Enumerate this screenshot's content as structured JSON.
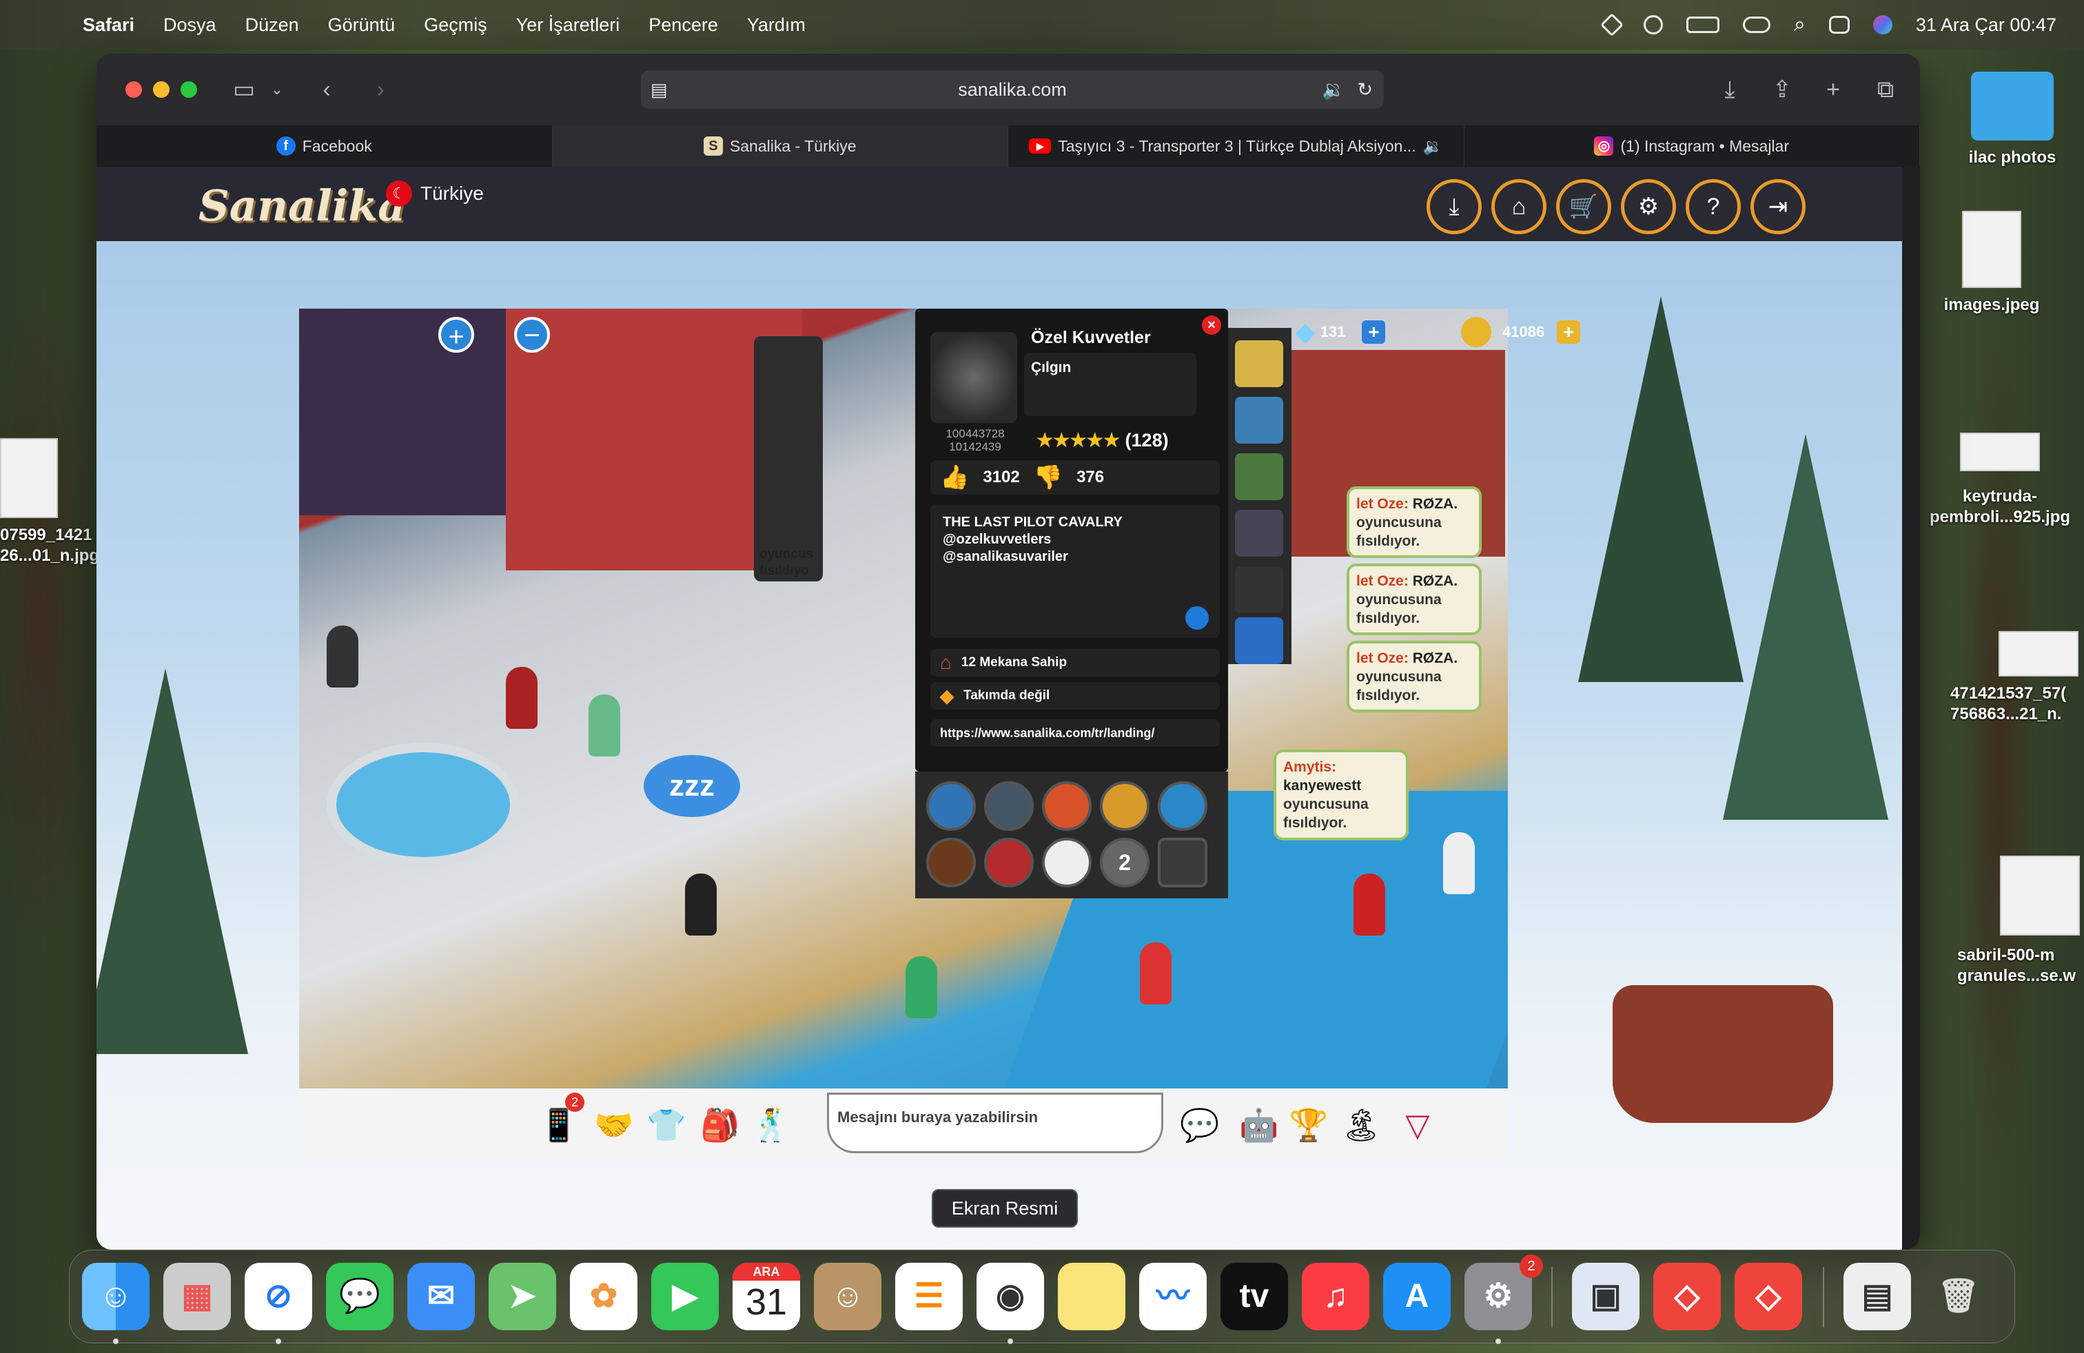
{
  "menubar": {
    "app": "Safari",
    "items": [
      "Dosya",
      "Düzen",
      "Görüntü",
      "Geçmiş",
      "Yer İşaretleri",
      "Pencere",
      "Yardım"
    ],
    "datetime": "31 Ara Çar 00:47"
  },
  "browser": {
    "url": "sanalika.com",
    "tabs": [
      {
        "label": "Facebook",
        "icon": "facebook-icon"
      },
      {
        "label": "Sanalika - Türkiye",
        "icon": "sanalika-icon"
      },
      {
        "label": "Taşıyıcı 3 - Transporter 3 | Türkçe Dublaj Aksiyon...",
        "icon": "youtube-icon"
      },
      {
        "label": "(1) Instagram • Mesajlar",
        "icon": "instagram-icon"
      }
    ]
  },
  "site": {
    "logo": "Sanalika",
    "country": "Türkiye",
    "header_buttons": [
      "download-icon",
      "home-icon",
      "cart-icon",
      "gear-icon",
      "help-icon",
      "logout-icon"
    ]
  },
  "profile": {
    "name": "Özel Kuvvetler",
    "status": "Çılgın",
    "id_line1": "100443728",
    "id_line2": "10142439",
    "stars": "★★★★★",
    "rating_count": "(128)",
    "likes": "3102",
    "dislikes": "376",
    "bio_line1": "THE LAST PILOT CAVALRY",
    "bio_line2": "@ozelkuvvetlers",
    "bio_line3": "@sanalikasuvariler",
    "places": "12 Mekana Sahip",
    "team": "Takımda değil",
    "link": "https://www.sanalika.com/tr/landing/"
  },
  "currency": {
    "diamonds": "131",
    "coins": "41086"
  },
  "whispers": [
    {
      "name": "let Oze:",
      "target": "RØZA.",
      "text1": "oyuncusuna",
      "text2": "fısıldıyor."
    },
    {
      "name": "let Oze:",
      "target": "RØZA.",
      "text1": "oyuncusuna",
      "text2": "fısıldıyor."
    },
    {
      "name": "let Oze:",
      "target": "RØZA.",
      "text1": "oyuncusuna",
      "text2": "fısıldıyor."
    },
    {
      "name": "Amytis:",
      "target": "kanyewestt",
      "text1": "oyuncusuna",
      "text2": "fısıldıyor."
    }
  ],
  "left_whisper": {
    "line1": "oyuncus",
    "line2": "fısıldıyo"
  },
  "chat": {
    "placeholder": "Mesajını buraya yazabilirsin",
    "phone_badge": "2"
  },
  "badge_number": "2",
  "tooltip": "Ekran Resmi",
  "desktop": [
    {
      "label1": "ilac photos",
      "label2": ""
    },
    {
      "label1": "images.jpeg",
      "label2": ""
    },
    {
      "label1": "keytruda-",
      "label2": "pembroli...925.jpg"
    },
    {
      "label1": "471421537_57(",
      "label2": "756863...21_n."
    },
    {
      "label1": "sabril-500-m",
      "label2": "granules...se.w"
    },
    {
      "label1": "07599_1421",
      "label2": "26...01_n.jpg"
    }
  ],
  "dock": {
    "calendar_month": "ARA",
    "calendar_day": "31",
    "settings_badge": "2",
    "tv_label": "tv"
  },
  "colors": {
    "accent": "#e89b2b",
    "close": "#e62020",
    "link_blue": "#2e7fd9"
  }
}
